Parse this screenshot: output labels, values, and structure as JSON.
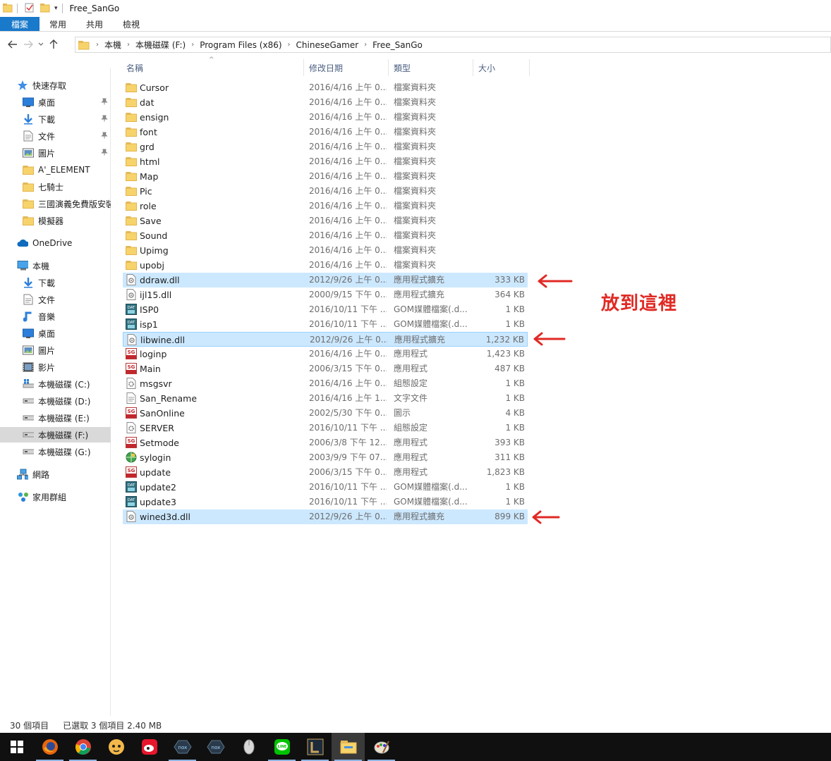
{
  "window": {
    "title": "Free_SanGo"
  },
  "ribbon": {
    "tabs": [
      "檔案",
      "常用",
      "共用",
      "檢視"
    ]
  },
  "address": {
    "crumbs": [
      "本機",
      "本機磁碟 (F:)",
      "Program Files (x86)",
      "ChineseGamer",
      "Free_SanGo"
    ]
  },
  "sidebar": {
    "items": [
      {
        "label": "快速存取",
        "icon": "star-icon"
      },
      {
        "label": "桌面",
        "icon": "desktop-icon",
        "pinned": true
      },
      {
        "label": "下載",
        "icon": "download-icon",
        "pinned": true
      },
      {
        "label": "文件",
        "icon": "document-icon",
        "pinned": true
      },
      {
        "label": "圖片",
        "icon": "picture-icon",
        "pinned": true
      },
      {
        "label": "A'_ELEMENT",
        "icon": "folder-icon"
      },
      {
        "label": "七騎士",
        "icon": "folder-icon"
      },
      {
        "label": "三國演義免費版安裝",
        "icon": "folder-icon"
      },
      {
        "label": "模擬器",
        "icon": "folder-icon"
      },
      {
        "label": "OneDrive",
        "icon": "cloud-icon"
      },
      {
        "label": "本機",
        "icon": "computer-icon"
      },
      {
        "label": "下載",
        "icon": "download-icon"
      },
      {
        "label": "文件",
        "icon": "document-icon"
      },
      {
        "label": "音樂",
        "icon": "music-icon"
      },
      {
        "label": "桌面",
        "icon": "desktop-icon"
      },
      {
        "label": "圖片",
        "icon": "picture-icon"
      },
      {
        "label": "影片",
        "icon": "video-icon"
      },
      {
        "label": "本機磁碟 (C:)",
        "icon": "windows-drive-icon"
      },
      {
        "label": "本機磁碟 (D:)",
        "icon": "drive-icon"
      },
      {
        "label": "本機磁碟 (E:)",
        "icon": "drive-icon"
      },
      {
        "label": "本機磁碟 (F:)",
        "icon": "drive-icon",
        "selected": true
      },
      {
        "label": "本機磁碟 (G:)",
        "icon": "drive-icon"
      },
      {
        "label": "網路",
        "icon": "network-icon"
      },
      {
        "label": "家用群組",
        "icon": "homegroup-icon"
      }
    ]
  },
  "columns": {
    "name": "名稱",
    "date": "修改日期",
    "type": "類型",
    "size": "大小"
  },
  "files": [
    {
      "name": "Cursor",
      "date": "2016/4/16 上午 0...",
      "type": "檔案資料夾",
      "size": "",
      "icon": "folder"
    },
    {
      "name": "dat",
      "date": "2016/4/16 上午 0...",
      "type": "檔案資料夾",
      "size": "",
      "icon": "folder"
    },
    {
      "name": "ensign",
      "date": "2016/4/16 上午 0...",
      "type": "檔案資料夾",
      "size": "",
      "icon": "folder"
    },
    {
      "name": "font",
      "date": "2016/4/16 上午 0...",
      "type": "檔案資料夾",
      "size": "",
      "icon": "folder"
    },
    {
      "name": "grd",
      "date": "2016/4/16 上午 0...",
      "type": "檔案資料夾",
      "size": "",
      "icon": "folder"
    },
    {
      "name": "html",
      "date": "2016/4/16 上午 0...",
      "type": "檔案資料夾",
      "size": "",
      "icon": "folder"
    },
    {
      "name": "Map",
      "date": "2016/4/16 上午 0...",
      "type": "檔案資料夾",
      "size": "",
      "icon": "folder"
    },
    {
      "name": "Pic",
      "date": "2016/4/16 上午 0...",
      "type": "檔案資料夾",
      "size": "",
      "icon": "folder"
    },
    {
      "name": "role",
      "date": "2016/4/16 上午 0...",
      "type": "檔案資料夾",
      "size": "",
      "icon": "folder"
    },
    {
      "name": "Save",
      "date": "2016/4/16 上午 0...",
      "type": "檔案資料夾",
      "size": "",
      "icon": "folder"
    },
    {
      "name": "Sound",
      "date": "2016/4/16 上午 0...",
      "type": "檔案資料夾",
      "size": "",
      "icon": "folder"
    },
    {
      "name": "Upimg",
      "date": "2016/4/16 上午 0...",
      "type": "檔案資料夾",
      "size": "",
      "icon": "folder"
    },
    {
      "name": "upobj",
      "date": "2016/4/16 上午 0...",
      "type": "檔案資料夾",
      "size": "",
      "icon": "folder"
    },
    {
      "name": "ddraw.dll",
      "date": "2012/9/26 上午 0...",
      "type": "應用程式擴充",
      "size": "333 KB",
      "icon": "dll",
      "selected": true
    },
    {
      "name": "ijl15.dll",
      "date": "2000/9/15 下午 0...",
      "type": "應用程式擴充",
      "size": "364 KB",
      "icon": "dll"
    },
    {
      "name": "ISP0",
      "date": "2016/10/11 下午 ...",
      "type": "GOM媒體檔案(.d...",
      "size": "1 KB",
      "icon": "dat"
    },
    {
      "name": "isp1",
      "date": "2016/10/11 下午 ...",
      "type": "GOM媒體檔案(.d...",
      "size": "1 KB",
      "icon": "dat"
    },
    {
      "name": "libwine.dll",
      "date": "2012/9/26 上午 0...",
      "type": "應用程式擴充",
      "size": "1,232 KB",
      "icon": "dll",
      "selected": true,
      "focus": true
    },
    {
      "name": "loginp",
      "date": "2016/4/16 上午 0...",
      "type": "應用程式",
      "size": "1,423 KB",
      "icon": "exe"
    },
    {
      "name": "Main",
      "date": "2006/3/15 下午 0...",
      "type": "應用程式",
      "size": "487 KB",
      "icon": "exe"
    },
    {
      "name": "msgsvr",
      "date": "2016/4/16 上午 0...",
      "type": "組態設定",
      "size": "1 KB",
      "icon": "ini"
    },
    {
      "name": "San_Rename",
      "date": "2016/4/16 上午 1...",
      "type": "文字文件",
      "size": "1 KB",
      "icon": "txt"
    },
    {
      "name": "SanOnline",
      "date": "2002/5/30 下午 0...",
      "type": "圖示",
      "size": "4 KB",
      "icon": "exe"
    },
    {
      "name": "SERVER",
      "date": "2016/10/11 下午 ...",
      "type": "組態設定",
      "size": "1 KB",
      "icon": "ini"
    },
    {
      "name": "Setmode",
      "date": "2006/3/8 下午 12...",
      "type": "應用程式",
      "size": "393 KB",
      "icon": "exe"
    },
    {
      "name": "sylogin",
      "date": "2003/9/9 下午 07...",
      "type": "應用程式",
      "size": "311 KB",
      "icon": "globe"
    },
    {
      "name": "update",
      "date": "2006/3/15 下午 0...",
      "type": "應用程式",
      "size": "1,823 KB",
      "icon": "exe"
    },
    {
      "name": "update2",
      "date": "2016/10/11 下午 ...",
      "type": "GOM媒體檔案(.d...",
      "size": "1 KB",
      "icon": "dat"
    },
    {
      "name": "update3",
      "date": "2016/10/11 下午 ...",
      "type": "GOM媒體檔案(.d...",
      "size": "1 KB",
      "icon": "dat"
    },
    {
      "name": "wined3d.dll",
      "date": "2012/9/26 上午 0...",
      "type": "應用程式擴充",
      "size": "899 KB",
      "icon": "dll",
      "selected": true
    }
  ],
  "annotation": {
    "text": "放到這裡",
    "color": "#e02a24"
  },
  "status": {
    "count": "30 個項目",
    "selection": "已選取 3 個項目  2.40 MB"
  },
  "taskbar": {
    "apps": [
      "windows-start-icon",
      "firefox-icon",
      "chrome-icon",
      "character-app-icon",
      "weibo-icon",
      "nox-icon",
      "nox-icon",
      "mouse-icon",
      "line-icon",
      "game-launcher-icon",
      "file-explorer-icon",
      "paint-icon"
    ],
    "active": "file-explorer-icon"
  },
  "colors": {
    "accent": "#1979ca",
    "selection": "#cce8ff",
    "annotation": "#e02a24"
  }
}
